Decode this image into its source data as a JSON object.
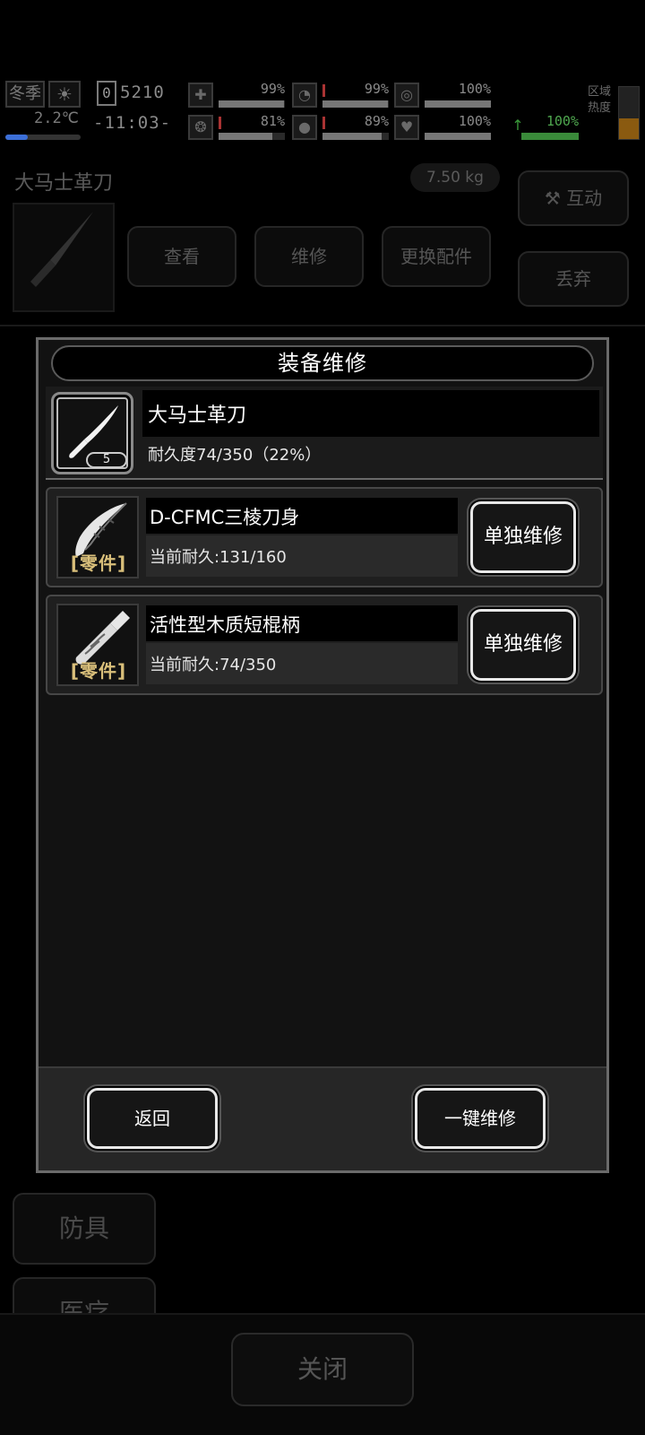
{
  "status": {
    "season": "冬季",
    "temperature": "2.2℃",
    "day": "0",
    "money": "5210",
    "clock": "-11:03-",
    "stats": [
      {
        "name": "health",
        "icon": "✚",
        "value": "99%"
      },
      {
        "name": "stomach",
        "icon": "◔",
        "value": "99%"
      },
      {
        "name": "stamina",
        "icon": "◎",
        "value": "100%"
      },
      {
        "name": "sanity",
        "icon": "❂",
        "value": "81%"
      },
      {
        "name": "water",
        "icon": "💧",
        "value": "89%"
      },
      {
        "name": "heart",
        "icon": "♥",
        "value": "100%"
      },
      {
        "name": "energy",
        "icon": "↑",
        "value": "100%"
      }
    ],
    "zone_label": "区域热度"
  },
  "background": {
    "item_title": "大马士革刀",
    "item_weight": "7.50 kg",
    "interact_label": "互动",
    "discard_label": "丢弃",
    "view_label": "查看",
    "repair_label": "维修",
    "replace_label": "更换配件",
    "side_armor": "防具",
    "side_medical": "医疗",
    "close_label": "关闭"
  },
  "modal": {
    "title": "装备维修",
    "main_item": {
      "name": "大马士革刀",
      "level": "5",
      "durability": "耐久度74/350（22%）"
    },
    "parts": [
      {
        "tag": "零件",
        "name": "D-CFMC三棱刀身",
        "durability": "当前耐久:131/160",
        "button": "单独维修"
      },
      {
        "tag": "零件",
        "name": "活性型木质短棍柄",
        "durability": "当前耐久:74/350",
        "button": "单独维修"
      }
    ],
    "back_label": "返回",
    "repair_all_label": "一键维修"
  },
  "colors": {
    "modal_border": "#6a6a6a",
    "part_tag": "#d9bf7a",
    "energy_green": "#4fa84f",
    "temp_blue": "#3c6fd8"
  }
}
